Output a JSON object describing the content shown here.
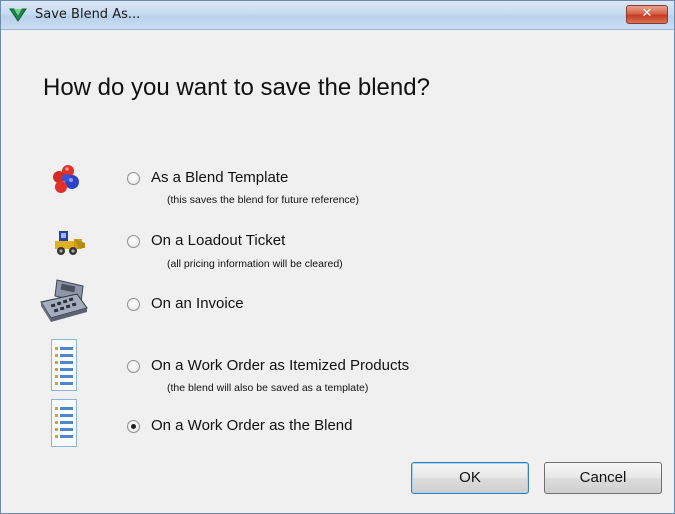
{
  "window": {
    "title": "Save Blend As...",
    "close_label": "✕"
  },
  "heading": "How do you want to save the blend?",
  "options": [
    {
      "label": "As a Blend Template",
      "sub": "(this saves the blend for future reference)",
      "icon": "blend-molecules-icon",
      "checked": false
    },
    {
      "label": "On a Loadout Ticket",
      "sub": "(all pricing information will be cleared)",
      "icon": "loader-truck-icon",
      "checked": false
    },
    {
      "label": "On an Invoice",
      "sub": "",
      "icon": "cash-register-icon",
      "checked": false
    },
    {
      "label": "On a Work Order as Itemized Products",
      "sub": "(the blend will also be saved as a template)",
      "icon": "itemized-list-icon",
      "checked": false
    },
    {
      "label": "On a Work Order as the Blend",
      "sub": "",
      "icon": "list-document-icon",
      "checked": true
    }
  ],
  "buttons": {
    "ok": "OK",
    "cancel": "Cancel"
  }
}
